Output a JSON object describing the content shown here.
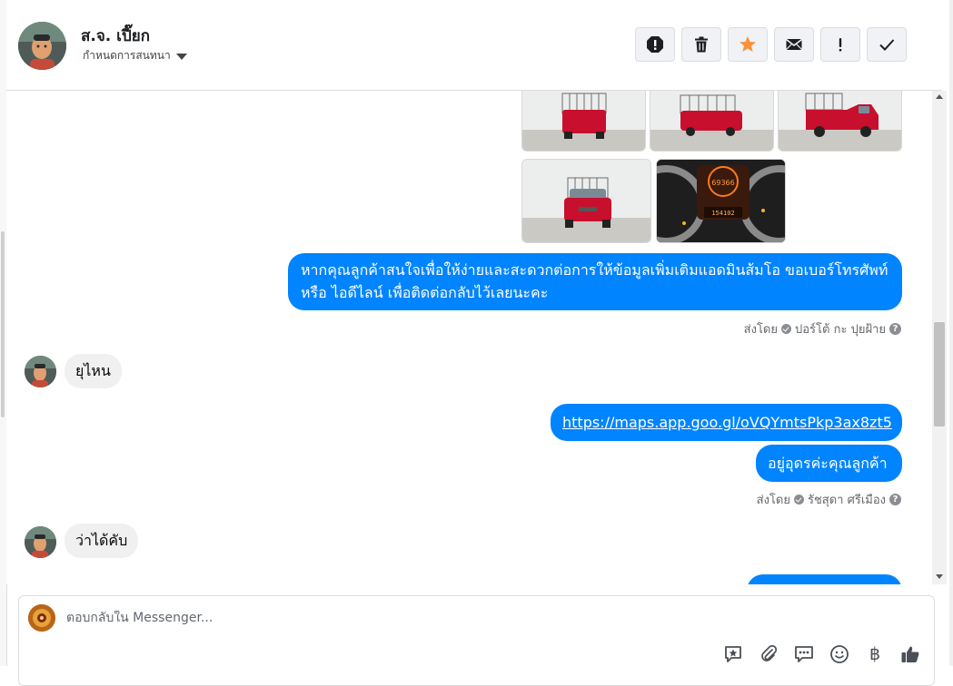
{
  "header": {
    "contact_name": "ส.จ. เปี๊ยก",
    "assign_label": "กำหนดการสนทนา",
    "actions": [
      {
        "name": "report-spam-button",
        "icon": "alert-icon"
      },
      {
        "name": "delete-button",
        "icon": "trash-icon"
      },
      {
        "name": "star-button",
        "icon": "star-icon"
      },
      {
        "name": "mark-unread-button",
        "icon": "envelope-icon"
      },
      {
        "name": "follow-up-button",
        "icon": "exclamation-icon"
      },
      {
        "name": "mark-done-button",
        "icon": "checkmark-icon"
      }
    ]
  },
  "messages": {
    "outgoing_1": "หากคุณลูกค้าสนใจเพื่อให้ง่ายและสะดวกต่อการให้ข้อมูลเพิ่มเติมแอดมินส้มโอ ขอเบอร์โทรศัพท์ หรือ ไอดีไลน์ เพื่อติดต่อกลับไว้เลยนะคะ",
    "sent_by_1_prefix": "ส่งโดย",
    "sent_by_1_name": "ปอร์โต้ กะ ปุยฝ้าย",
    "incoming_1": "ยุไหน",
    "outgoing_link": "https://maps.app.goo.gl/oVQYmtsPkp3ax8zt5",
    "outgoing_2": "อยู่อุดรค่ะคุณลูกค้า",
    "sent_by_2_prefix": "ส่งโดย",
    "sent_by_2_name": "รัชสุดา ศรีเมือง",
    "incoming_2": "ว่าได้คับ",
    "dash_odometer": "69366",
    "dash_reading": "154102"
  },
  "composer": {
    "placeholder": "ตอบกลับใน Messenger...",
    "baht_symbol": "฿"
  },
  "colors": {
    "accent": "#0084ff",
    "star": "#f7923b",
    "car_red": "#c8102e"
  }
}
